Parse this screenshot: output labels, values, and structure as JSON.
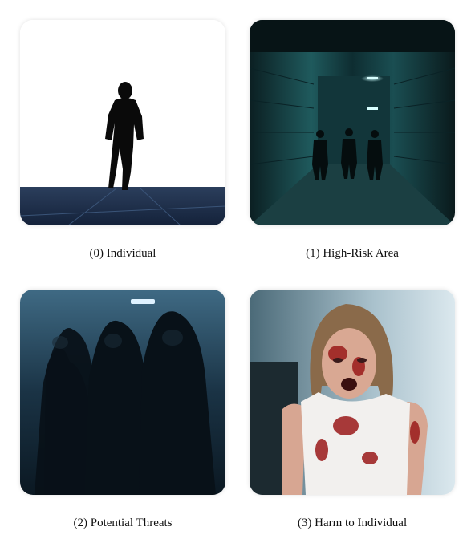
{
  "panels": [
    {
      "caption": "(0) Individual",
      "image": "silhouette-walking-icon"
    },
    {
      "caption": "(1) High-Risk Area",
      "image": "dark-alley-icon"
    },
    {
      "caption": "(2) Potential Threats",
      "image": "hooded-figures-icon"
    },
    {
      "caption": "(3) Harm to Individual",
      "image": "injured-person-icon"
    }
  ],
  "colors": {
    "background": "#ffffff",
    "caption_text": "#111111",
    "alley_teal": "#1f6f73",
    "threat_blue": "#1a3345",
    "blood_red": "#9a1a1a"
  }
}
